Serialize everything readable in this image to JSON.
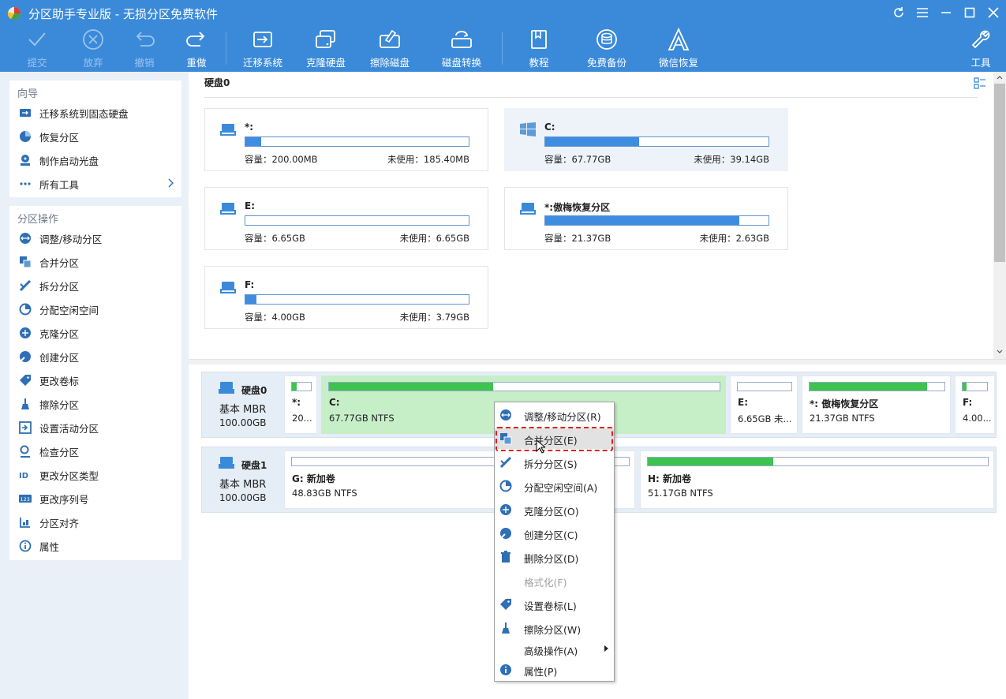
{
  "window": {
    "title": "分区助手专业版 - 无损分区免费软件"
  },
  "toolbar": {
    "commit": "提交",
    "discard": "放弃",
    "undo": "撤销",
    "redo": "重做",
    "migrate_os": "迁移系统",
    "clone_disk": "克隆硬盘",
    "wipe_disk": "擦除磁盘",
    "disk_convert": "磁盘转换",
    "tutorial": "教程",
    "free_backup": "免费备份",
    "wechat_recovery": "微信恢复",
    "tools": "工具"
  },
  "sidebar": {
    "wizard": {
      "header": "向导",
      "items": [
        "迁移系统到固态硬盘",
        "恢复分区",
        "制作启动光盘",
        "所有工具"
      ]
    },
    "operations": {
      "header": "分区操作",
      "items": [
        "调整/移动分区",
        "合并分区",
        "拆分分区",
        "分配空闲空间",
        "克隆分区",
        "创建分区",
        "更改卷标",
        "擦除分区",
        "设置活动分区",
        "检查分区",
        "更改分区类型",
        "更改序列号",
        "分区对齐",
        "属性"
      ]
    }
  },
  "main": {
    "disk_title": "硬盘0",
    "cards": [
      {
        "name": "*:",
        "capacity": "容量：200.00MB",
        "free": "未使用：185.40MB",
        "used_fraction": 0.07
      },
      {
        "name": "C:",
        "capacity": "容量：67.77GB",
        "free": "未使用：39.14GB",
        "used_fraction": 0.42
      },
      {
        "name": "E:",
        "capacity": "容量：6.65GB",
        "free": "未使用：6.65GB",
        "used_fraction": 0.0
      },
      {
        "name": "*:傲梅恢复分区",
        "capacity": "容量：21.37GB",
        "free": "未使用：2.63GB",
        "used_fraction": 0.87
      },
      {
        "name": "F:",
        "capacity": "容量：4.00GB",
        "free": "未使用：3.79GB",
        "used_fraction": 0.05
      }
    ]
  },
  "diskmap": {
    "disk0": {
      "name": "硬盘0",
      "type": "基本 MBR",
      "size": "100.00GB",
      "parts": [
        {
          "name": "*:",
          "info": "20...",
          "used_fraction": 0.25
        },
        {
          "name": "C:",
          "info": "67.77GB NTFS",
          "used_fraction": 0.42
        },
        {
          "name": "E:",
          "info": "6.65GB 未...",
          "used_fraction": 0.0
        },
        {
          "name": "*: 傲梅恢复分区",
          "info": "21.37GB NTFS",
          "used_fraction": 0.87
        },
        {
          "name": "F:",
          "info": "4.00...",
          "used_fraction": 0.15
        }
      ]
    },
    "disk1": {
      "name": "硬盘1",
      "type": "基本 MBR",
      "size": "100.00GB",
      "parts": [
        {
          "name": "G: 新加卷",
          "info": "48.83GB NTFS",
          "used_fraction": 0.0
        },
        {
          "name": "H: 新加卷",
          "info": "51.17GB NTFS",
          "used_fraction": 0.37
        }
      ]
    }
  },
  "context_menu": {
    "items": [
      {
        "label": "调整/移动分区(R)",
        "disabled": false
      },
      {
        "label": "合并分区(E)",
        "disabled": false
      },
      {
        "label": "拆分分区(S)",
        "disabled": false
      },
      {
        "label": "分配空闲空间(A)",
        "disabled": false
      },
      {
        "label": "克隆分区(O)",
        "disabled": false
      },
      {
        "label": "创建分区(C)",
        "disabled": false
      },
      {
        "label": "删除分区(D)",
        "disabled": false
      },
      {
        "label": "格式化(F)",
        "disabled": true
      },
      {
        "label": "设置卷标(L)",
        "disabled": false
      },
      {
        "label": "擦除分区(W)",
        "disabled": false
      },
      {
        "label": "高级操作(A)",
        "disabled": false
      },
      {
        "label": "属性(P)",
        "disabled": false
      }
    ],
    "highlighted_index": 1
  },
  "colors": {
    "toolbar_bg": "#3b8ad9",
    "sidebar_bg": "#eaf0f7",
    "usage_blue": "#3f8de0",
    "usage_green": "#3cc44e",
    "selected_partition": "#c6efc8",
    "highlight_dashed": "#e02020"
  }
}
